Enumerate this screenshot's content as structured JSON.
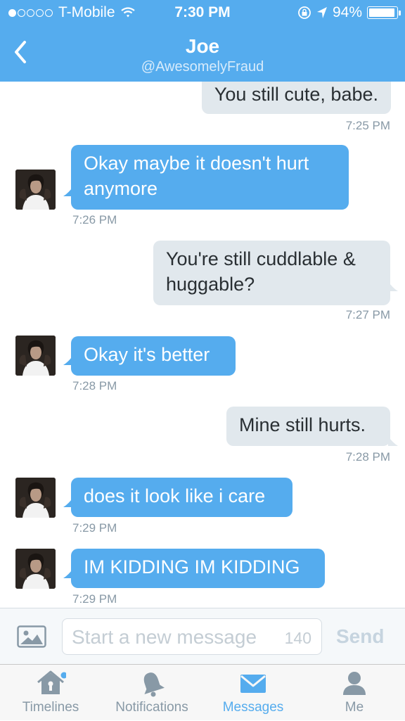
{
  "status_bar": {
    "carrier": "T-Mobile",
    "time": "7:30 PM",
    "battery": "94%",
    "battery_level": 0.94,
    "signal_bars": 1
  },
  "header": {
    "title": "Joe",
    "handle": "@AwesomelyFraud"
  },
  "colors": {
    "accent": "#55acee",
    "incoming_bubble": "#55acee",
    "outgoing_bubble": "#e1e8ed",
    "timestamp": "#8899a6"
  },
  "messages": [
    {
      "direction": "outgoing",
      "lines": [
        "You still cute, babe."
      ],
      "time": "7:25 PM"
    },
    {
      "direction": "incoming",
      "lines": [
        "Okay maybe it doesn't hurt",
        "anymore"
      ],
      "time": "7:26 PM"
    },
    {
      "direction": "outgoing",
      "lines": [
        "You're still cuddlable &",
        "huggable?"
      ],
      "time": "7:27 PM"
    },
    {
      "direction": "incoming",
      "lines": [
        "Okay it's better"
      ],
      "time": "7:28 PM"
    },
    {
      "direction": "outgoing",
      "lines": [
        "Mine still hurts."
      ],
      "time": "7:28 PM"
    },
    {
      "direction": "incoming",
      "lines": [
        "does it look like i care"
      ],
      "time": "7:29 PM"
    },
    {
      "direction": "incoming",
      "lines": [
        "IM KIDDING IM KIDDING"
      ],
      "time": "7:29 PM"
    }
  ],
  "composer": {
    "placeholder": "Start a new message",
    "char_count": "140",
    "send_label": "Send",
    "photo_icon": "photo-icon"
  },
  "tabs": [
    {
      "label": "Timelines",
      "icon": "home-icon",
      "active": false,
      "badge": true
    },
    {
      "label": "Notifications",
      "icon": "bell-icon",
      "active": false
    },
    {
      "label": "Messages",
      "icon": "envelope-icon",
      "active": true
    },
    {
      "label": "Me",
      "icon": "person-icon",
      "active": false
    }
  ]
}
